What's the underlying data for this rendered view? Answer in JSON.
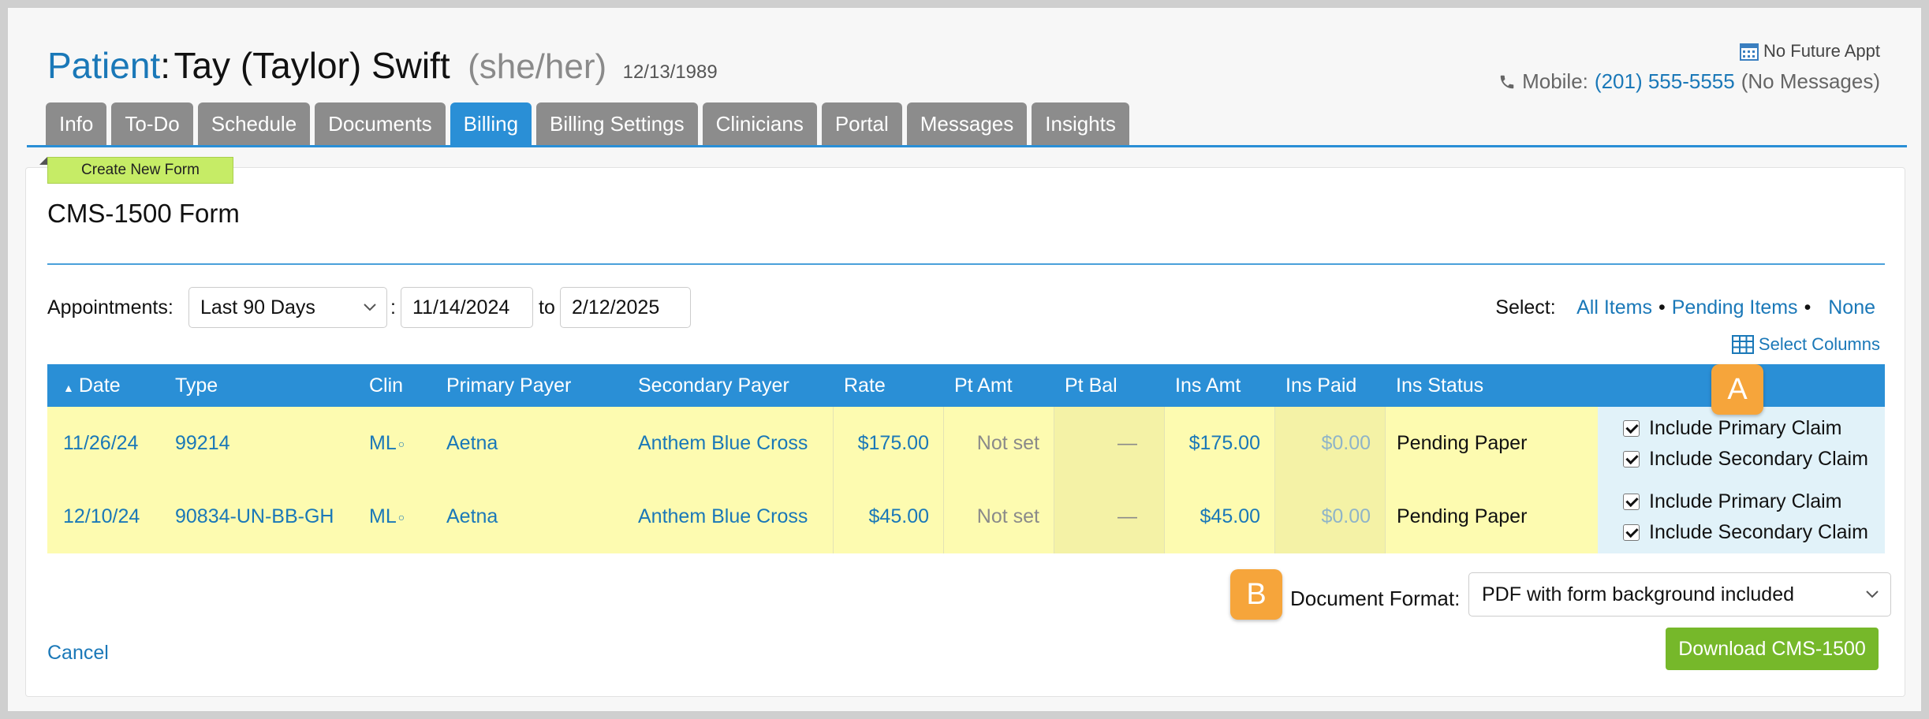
{
  "patient": {
    "label": "Patient",
    "colon": ":",
    "name": "Tay (Taylor) Swift",
    "pronouns": "(she/her)",
    "dob": "12/13/1989"
  },
  "contact": {
    "future_appt": "No Future Appt",
    "mobile_label": "Mobile:",
    "mobile_number": "(201) 555-5555",
    "messages_note": "(No Messages)"
  },
  "tabs": [
    {
      "label": "Info",
      "active": false
    },
    {
      "label": "To-Do",
      "active": false
    },
    {
      "label": "Schedule",
      "active": false
    },
    {
      "label": "Documents",
      "active": false
    },
    {
      "label": "Billing",
      "active": true
    },
    {
      "label": "Billing Settings",
      "active": false
    },
    {
      "label": "Clinicians",
      "active": false
    },
    {
      "label": "Portal",
      "active": false
    },
    {
      "label": "Messages",
      "active": false
    },
    {
      "label": "Insights",
      "active": false
    }
  ],
  "form": {
    "create_new_label": "Create New Form",
    "title": "CMS-1500 Form"
  },
  "filters": {
    "appointments_label": "Appointments:",
    "range": "Last 90 Days",
    "colon": ":",
    "from_date": "11/14/2024",
    "to_label": "to",
    "to_date": "2/12/2025"
  },
  "select": {
    "label": "Select:",
    "all": "All Items",
    "pending": "Pending Items",
    "none": "None",
    "bullet": "•",
    "columns": "Select Columns"
  },
  "table": {
    "sort_arrow": "▲",
    "headers": [
      "Date",
      "Type",
      "Clin",
      "Primary Payer",
      "Secondary Payer",
      "Rate",
      "Pt Amt",
      "Pt Bal",
      "Ins Amt",
      "Ins Paid",
      "Ins Status"
    ],
    "rows": [
      {
        "date": "11/26/24",
        "type": "99214",
        "clin": "ML",
        "clin_mark": "○",
        "primary": "Aetna",
        "secondary": "Anthem Blue Cross",
        "rate": "$175.00",
        "pt_amt": "Not set",
        "pt_bal": "—",
        "ins_amt": "$175.00",
        "ins_paid": "$0.00",
        "status": "Pending Paper",
        "include_primary": "Include Primary Claim",
        "include_secondary": "Include Secondary Claim"
      },
      {
        "date": "12/10/24",
        "type": "90834-UN-BB-GH",
        "clin": "ML",
        "clin_mark": "○",
        "primary": "Aetna",
        "secondary": "Anthem Blue Cross",
        "rate": "$45.00",
        "pt_amt": "Not set",
        "pt_bal": "—",
        "ins_amt": "$45.00",
        "ins_paid": "$0.00",
        "status": "Pending Paper",
        "include_primary": "Include Primary Claim",
        "include_secondary": "Include Secondary Claim"
      }
    ]
  },
  "badges": {
    "a": "A",
    "b": "B"
  },
  "document_format": {
    "label": "Document Format:",
    "value": "PDF with form background included"
  },
  "actions": {
    "cancel": "Cancel",
    "download": "Download CMS-1500"
  },
  "icons": {
    "calendar": "calendar-icon",
    "phone": "phone-icon",
    "grid": "table-grid-icon",
    "chevron": "chevron-down-icon"
  },
  "colors": {
    "accent": "#2a8fd6",
    "link": "#1a78b8",
    "row_highlight": "#fdfbb0",
    "create_button": "#c6ec66",
    "download_button": "#76b82a",
    "badge": "#f6a53b"
  }
}
